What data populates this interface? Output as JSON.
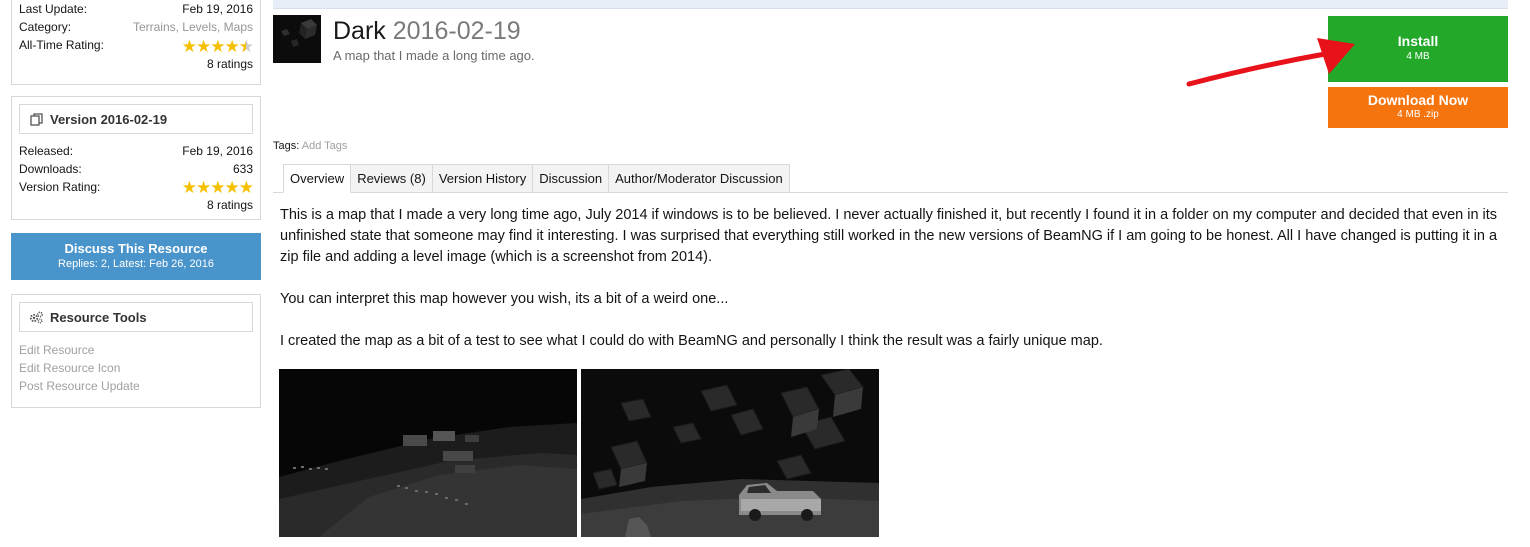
{
  "sidebar": {
    "info": {
      "last_update_label": "Last Update:",
      "last_update_value": "Feb 19, 2016",
      "category_label": "Category:",
      "category_value": "Terrains, Levels, Maps",
      "rating_label": "All-Time Rating:",
      "rating_stars": 4.5,
      "rating_count": "8 ratings"
    },
    "version": {
      "header": "Version 2016-02-19",
      "released_label": "Released:",
      "released_value": "Feb 19, 2016",
      "downloads_label": "Downloads:",
      "downloads_value": "633",
      "rating_label": "Version Rating:",
      "rating_stars": 5,
      "rating_count": "8 ratings"
    },
    "discuss": {
      "title": "Discuss This Resource",
      "subtitle": "Replies: 2, Latest: Feb 26, 2016"
    },
    "tools": {
      "header": "Resource Tools",
      "links": [
        "Edit Resource",
        "Edit Resource Icon",
        "Post Resource Update"
      ]
    }
  },
  "resource": {
    "title": "Dark",
    "version": "2016-02-19",
    "tagline": "A map that I made a long time ago."
  },
  "install": {
    "label": "Install",
    "size": "4 MB"
  },
  "download": {
    "label": "Download Now",
    "size": "4 MB .zip"
  },
  "tags": {
    "label": "Tags:",
    "add": "Add Tags"
  },
  "tabs": [
    "Overview",
    "Reviews (8)",
    "Version History",
    "Discussion",
    "Author/Moderator Discussion"
  ],
  "description": [
    "This is a map that I made a very long time ago, July 2014 if windows is to be believed. I never actually finished it, but recently I found it in a folder on my computer and decided that even in its unfinished state that someone may find it interesting. I was surprised that everything still worked in the new versions of BeamNG if I am going to be honest. All I have changed is putting it in a zip file and adding a level image (which is a screenshot from 2014).",
    "You can interpret this map however you wish, its a bit of a weird one...",
    "I created the map as a bit of a test to see what I could do with BeamNG and personally I think the result was a fairly unique map."
  ],
  "colors": {
    "install": "#23a82a",
    "download": "#f6740e",
    "discuss": "#4a94cc",
    "stars": "#f5c000",
    "annotation_arrow": "#e8121a"
  }
}
